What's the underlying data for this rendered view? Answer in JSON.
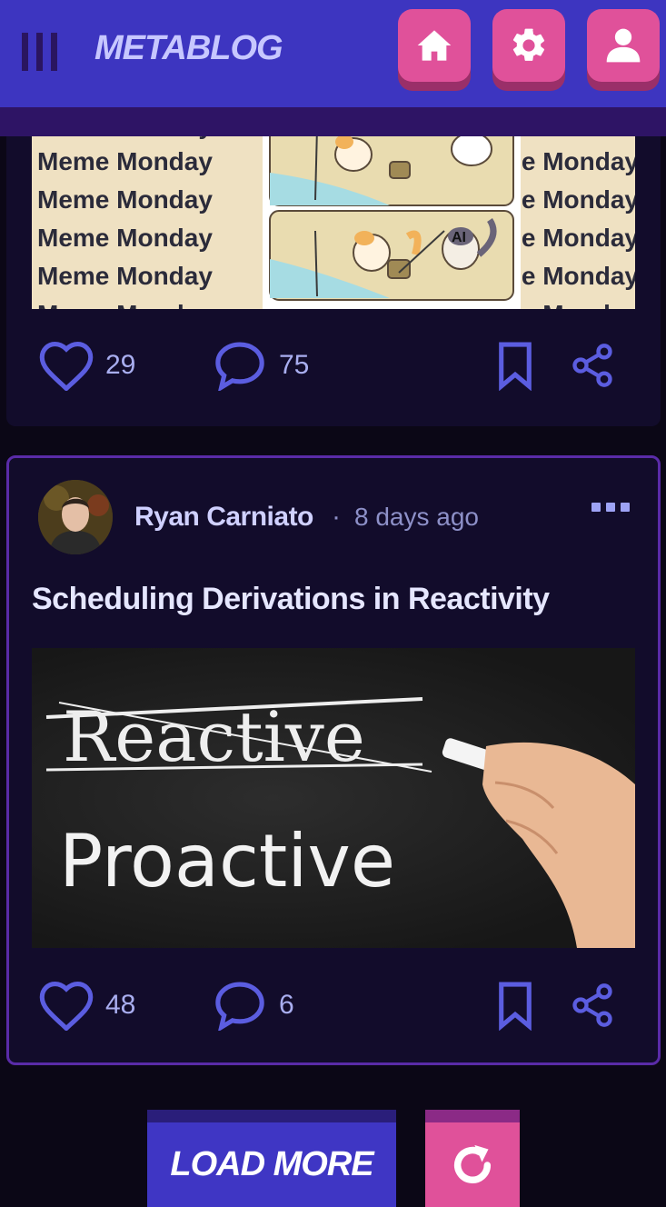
{
  "header": {
    "brand": "METABLOG",
    "nav": [
      {
        "name": "home",
        "icon": "home-icon"
      },
      {
        "name": "settings",
        "icon": "gear-icon"
      },
      {
        "name": "profile",
        "icon": "user-icon"
      }
    ]
  },
  "posts": [
    {
      "image_text": "Meme Monday",
      "image_badge": "AI",
      "likes": "29",
      "comments": "75"
    },
    {
      "author": "Ryan Carniato",
      "separator": "·",
      "time": "8 days ago",
      "title": "Scheduling Derivations in Reactivity",
      "image_strike_word": "Reactive",
      "image_main_word": "Proactive",
      "likes": "48",
      "comments": "6"
    }
  ],
  "footer": {
    "load_more_label": "LOAD MORE"
  },
  "colors": {
    "header_bg": "#3d35c0",
    "accent_pink": "#e0519a",
    "card_bg": "#120c2b",
    "icon_blue": "#5b5de0"
  }
}
